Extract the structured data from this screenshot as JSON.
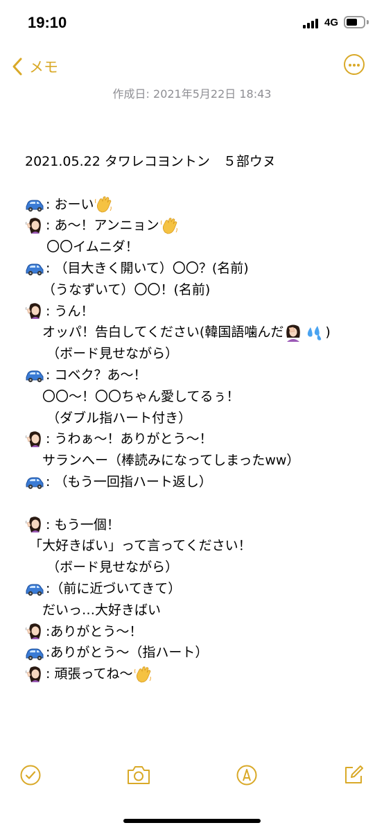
{
  "status_bar": {
    "time": "19:10",
    "network": "4G"
  },
  "nav": {
    "back_label": "メモ"
  },
  "note": {
    "created": "作成日: 2021年5月22日 18:43",
    "lines": [
      {
        "type": "text",
        "text": "2021.05.22 タワレコヨントン　５部ウヌ"
      },
      {
        "type": "blank"
      },
      {
        "type": "line",
        "speaker": "car",
        "text": ": おーい",
        "end": "wave"
      },
      {
        "type": "line",
        "speaker": "woman",
        "text": ": あ〜！アンニョン",
        "end": "wave"
      },
      {
        "type": "text",
        "text": "　  〇〇イムニダ！"
      },
      {
        "type": "line",
        "speaker": "car",
        "text": ": （目大きく開いて）〇〇？(名前)"
      },
      {
        "type": "text",
        "text": "　 （うなずいて）〇〇！(名前)"
      },
      {
        "type": "line",
        "speaker": "woman",
        "text": ": うん！"
      },
      {
        "type": "text",
        "text": "　 オッパ！告白してください(韓国語噛んだ",
        "end": "facepalm",
        "after": ")"
      },
      {
        "type": "text",
        "text": "　  （ボード見せながら）"
      },
      {
        "type": "line",
        "speaker": "car",
        "text": ": コベク？あ〜！"
      },
      {
        "type": "text",
        "text": "　 〇〇〜！〇〇ちゃん愛してるぅ！"
      },
      {
        "type": "text",
        "text": "　  （ダブル指ハート付き）"
      },
      {
        "type": "line",
        "speaker": "woman",
        "text": ": うわぁ〜！ありがとう〜！"
      },
      {
        "type": "text",
        "text": "　 サランへー（棒読みになってしまったww）"
      },
      {
        "type": "line",
        "speaker": "car",
        "text": ": （もう一回指ハート返し）"
      },
      {
        "type": "blank"
      },
      {
        "type": "line",
        "speaker": "woman",
        "text": ": もう一個！"
      },
      {
        "type": "text",
        "text": " 「大好きばい」って言ってください！"
      },
      {
        "type": "text",
        "text": "　  （ボード見せながら）"
      },
      {
        "type": "line",
        "speaker": "car",
        "text": ":（前に近づいてきて）"
      },
      {
        "type": "text",
        "text": "　 だいっ…大好きばい"
      },
      {
        "type": "line",
        "speaker": "woman",
        "text": ":ありがとう〜！"
      },
      {
        "type": "line",
        "speaker": "car",
        "text": ":ありがとう〜（指ハート）"
      },
      {
        "type": "line",
        "speaker": "woman",
        "text": ": 頑張ってね〜",
        "end": "wave"
      }
    ]
  },
  "toolbar": {
    "items": [
      {
        "name": "checklist-button",
        "icon": "checkmark-circle-icon"
      },
      {
        "name": "camera-button",
        "icon": "camera-icon"
      },
      {
        "name": "markup-button",
        "icon": "pen-tip-icon"
      },
      {
        "name": "compose-button",
        "icon": "compose-icon"
      }
    ]
  },
  "colors": {
    "accent": "#d9a928",
    "secondary_text": "#8e8e93"
  }
}
